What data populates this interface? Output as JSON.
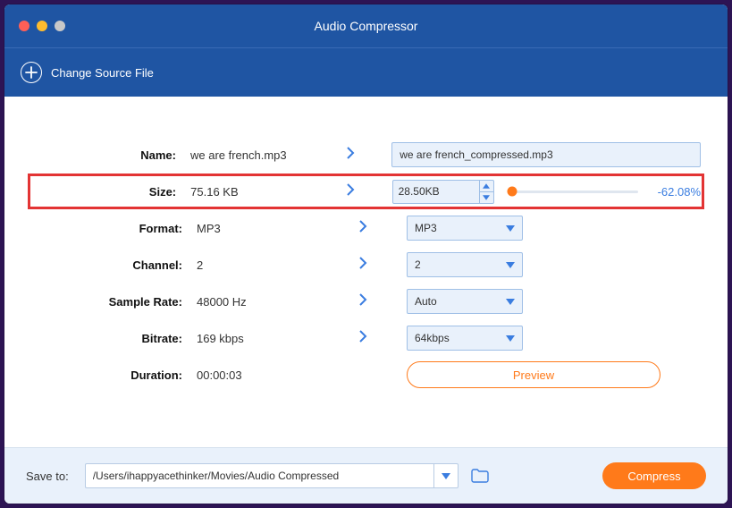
{
  "window": {
    "title": "Audio Compressor"
  },
  "toolbar": {
    "change_source": "Change Source File"
  },
  "rows": {
    "name": {
      "label": "Name:",
      "source": "we are french.mp3",
      "output": "we are french_compressed.mp3"
    },
    "size": {
      "label": "Size:",
      "source": "75.16 KB",
      "output": "28.50KB",
      "percent": "-62.08%"
    },
    "format": {
      "label": "Format:",
      "source": "MP3",
      "output": "MP3"
    },
    "channel": {
      "label": "Channel:",
      "source": "2",
      "output": "2"
    },
    "sample_rate": {
      "label": "Sample Rate:",
      "source": "48000 Hz",
      "output": "Auto"
    },
    "bitrate": {
      "label": "Bitrate:",
      "source": "169 kbps",
      "output": "64kbps"
    },
    "duration": {
      "label": "Duration:",
      "value": "00:00:03",
      "preview": "Preview"
    }
  },
  "footer": {
    "save_to": "Save to:",
    "path": "/Users/ihappyacethinker/Movies/Audio Compressed",
    "compress": "Compress"
  }
}
